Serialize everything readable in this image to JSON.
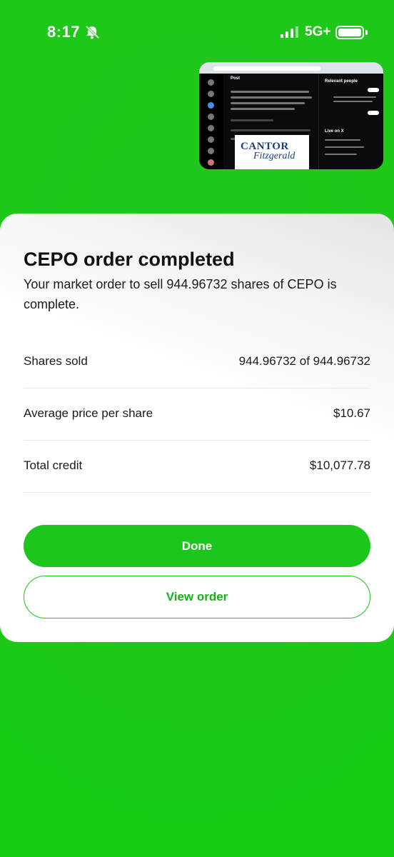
{
  "status_bar": {
    "time": "8:17",
    "network": "5G+",
    "silent_icon": "bell-slash-icon",
    "signal_icon": "cellular-signal-icon",
    "battery_icon": "battery-icon"
  },
  "pip": {
    "header": "Post",
    "sidebar_title": "Relevant people",
    "live_title": "Live on X",
    "logo_line1": "CANTOR",
    "logo_line2": "Fitzgerald"
  },
  "order": {
    "title": "CEPO order completed",
    "message": "Your market order to sell 944.96732 shares of CEPO is complete.",
    "details": [
      {
        "label": "Shares sold",
        "value": "944.96732 of 944.96732"
      },
      {
        "label": "Average price per share",
        "value": "$10.67"
      },
      {
        "label": "Total credit",
        "value": "$10,077.78"
      }
    ],
    "done_label": "Done",
    "view_order_label": "View order"
  },
  "colors": {
    "brand_green": "#1cc61a",
    "background_green": "#1ec818",
    "card": "#ffffff"
  }
}
